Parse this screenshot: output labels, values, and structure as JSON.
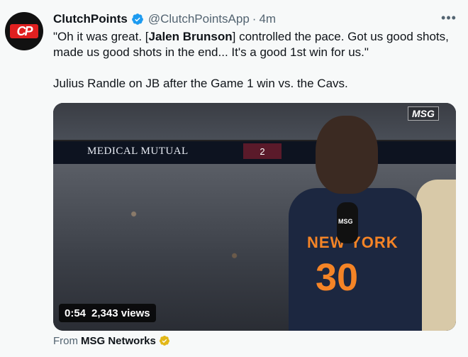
{
  "tweet": {
    "avatar_text": "CP",
    "author_name": "ClutchPoints",
    "handle": "@ClutchPointsApp",
    "separator": "·",
    "time": "4m",
    "more_label": "•••",
    "text_part1": "\"Oh it was great. [",
    "text_bold": "Jalen Brunson",
    "text_part2": "] controlled the pace. Got us good shots, made us good shots in the end... It's a good 1st win for us.\"",
    "text_line2": "Julius Randle on JB after the Game 1 win vs. the Cavs."
  },
  "media": {
    "watermark": "MSG",
    "scoreboard_sponsor": "MEDICAL MUTUAL",
    "scoreboard_score": "2",
    "jersey_text": "NEW YORK",
    "jersey_number": "30",
    "mic_label": "MSG",
    "duration": "0:54",
    "views": "2,343 views"
  },
  "source": {
    "prefix": "From",
    "name": "MSG Networks"
  },
  "colors": {
    "verified_blue": "#1d9bf0",
    "knicks_orange": "#f58426",
    "gold_badge": "#e2b719"
  }
}
